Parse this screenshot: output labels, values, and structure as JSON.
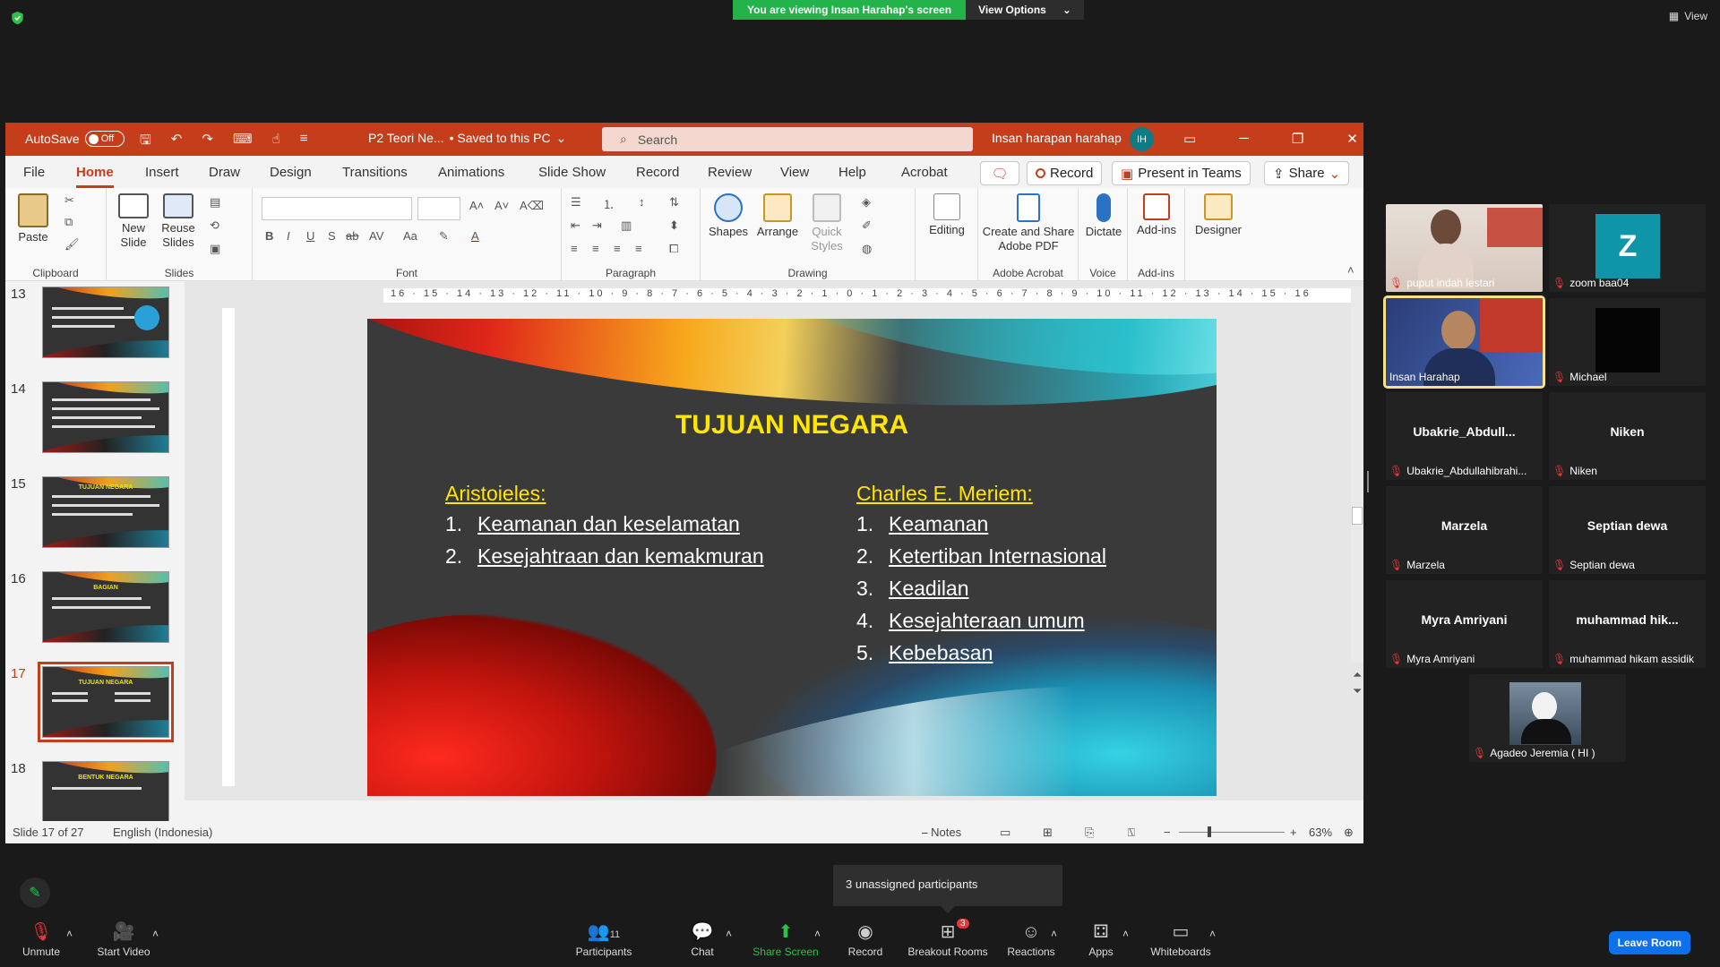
{
  "zoom": {
    "banner": "You are viewing Insan Harahap's screen",
    "view_options": "View Options",
    "view": "View",
    "tooltip": "3 unassigned participants",
    "bottom": {
      "unmute": "Unmute",
      "start_video": "Start Video",
      "participants": "Participants",
      "participants_count": "11",
      "chat": "Chat",
      "share_screen": "Share Screen",
      "record": "Record",
      "breakout": "Breakout Rooms",
      "breakout_badge": "3",
      "reactions": "Reactions",
      "apps": "Apps",
      "whiteboards": "Whiteboards",
      "leave": "Leave Room"
    },
    "participants": [
      {
        "name": "puput indah lestari",
        "big": ""
      },
      {
        "name": "zoom baa04",
        "big": "Z"
      },
      {
        "name": "Insan Harahap",
        "big": ""
      },
      {
        "name": "Michael",
        "big": ""
      },
      {
        "name": "Ubakrie_Abdullahibrahi...",
        "big": "Ubakrie_Abdull..."
      },
      {
        "name": "Niken",
        "big": "Niken"
      },
      {
        "name": "Marzela",
        "big": "Marzela"
      },
      {
        "name": "Septian dewa",
        "big": "Septian dewa"
      },
      {
        "name": "Myra Amriyani",
        "big": "Myra Amriyani"
      },
      {
        "name": "muhammad hikam assidik",
        "big": "muhammad  hik..."
      },
      {
        "name": "Agadeo Jeremia ( HI )",
        "big": ""
      }
    ]
  },
  "ppt": {
    "autosave": "AutoSave",
    "autosave_state": "Off",
    "doc": "P2 Teori Ne...",
    "saved": "• Saved to this PC",
    "search": "Search",
    "user": "Insan harapan harahap",
    "initials": "IH",
    "tabs": [
      "File",
      "Home",
      "Insert",
      "Draw",
      "Design",
      "Transitions",
      "Animations",
      "Slide Show",
      "Record",
      "Review",
      "View",
      "Help",
      "Acrobat"
    ],
    "record_btn": "Record",
    "present_btn": "Present in Teams",
    "share_btn": "Share",
    "ribbon": {
      "paste": "Paste",
      "clipboard": "Clipboard",
      "new_slide": "New Slide",
      "reuse": "Reuse Slides",
      "slides": "Slides",
      "font": "Font",
      "paragraph": "Paragraph",
      "shapes": "Shapes",
      "arrange": "Arrange",
      "quick_styles": "Quick Styles",
      "drawing": "Drawing",
      "editing": "Editing",
      "adobe": "Create and Share Adobe PDF",
      "adobe_acrobat": "Adobe Acrobat",
      "dictate": "Dictate",
      "voice": "Voice",
      "addins": "Add-ins",
      "addins_group": "Add-ins",
      "designer": "Designer"
    },
    "thumbs": [
      {
        "num": "13",
        "title": ""
      },
      {
        "num": "14",
        "title": ""
      },
      {
        "num": "15",
        "title": "TUJUAN NEGARA"
      },
      {
        "num": "16",
        "title": "BAGIAN"
      },
      {
        "num": "17",
        "title": "TUJUAN NEGARA"
      },
      {
        "num": "18",
        "title": "BENTUK NEGARA"
      }
    ],
    "ruler": "16 · 15 · 14 · 13 · 12 · 11 · 10 · 9 · 8 · 7 · 6 · 5 · 4 · 3 · 2 · 1 · 0 · 1 · 2 · 3 · 4 · 5 · 6 · 7 · 8 · 9 · 10 · 11 · 12 · 13 · 14 · 15 · 16",
    "slide": {
      "title": "TUJUAN NEGARA",
      "left_head": "Aristoieles:",
      "left_items": [
        {
          "n": "1.",
          "t": "Keamanan dan keselamatan"
        },
        {
          "n": "2.",
          "t": "Kesejahtraan dan kemakmuran"
        }
      ],
      "right_head": "Charles E. Meriem:",
      "right_items": [
        {
          "n": "1.",
          "t": "Keamanan"
        },
        {
          "n": "2.",
          "t": "Ketertiban Internasional"
        },
        {
          "n": "3.",
          "t": "Keadilan"
        },
        {
          "n": "4.",
          "t": "Kesejahteraan umum"
        },
        {
          "n": "5.",
          "t": "Kebebasan"
        }
      ]
    },
    "status": {
      "slide": "Slide 17 of 27",
      "lang": "English (Indonesia)",
      "notes": "Notes",
      "zoom": "63%"
    }
  }
}
